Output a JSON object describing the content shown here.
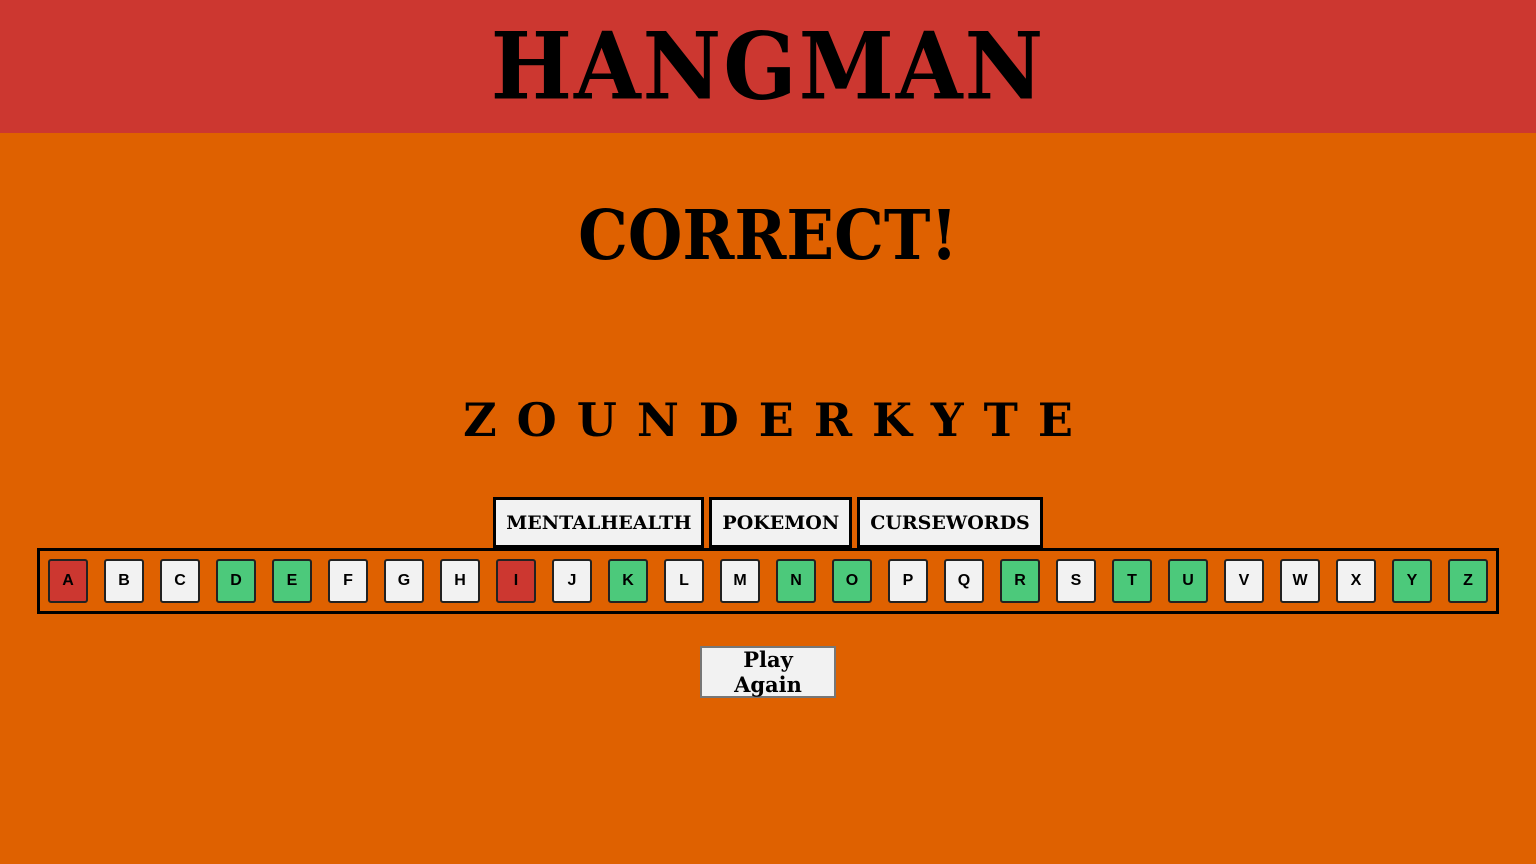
{
  "header": {
    "title": "HANGMAN"
  },
  "game": {
    "status": "CORRECT!",
    "word": "ZOUNDERKYTE"
  },
  "categories": [
    "MENTALHEALTH",
    "POKEMON",
    "CURSEWORDS"
  ],
  "keyboard": {
    "keys": [
      {
        "letter": "A",
        "state": "wrong"
      },
      {
        "letter": "B",
        "state": "unused"
      },
      {
        "letter": "C",
        "state": "unused"
      },
      {
        "letter": "D",
        "state": "correct"
      },
      {
        "letter": "E",
        "state": "correct"
      },
      {
        "letter": "F",
        "state": "unused"
      },
      {
        "letter": "G",
        "state": "unused"
      },
      {
        "letter": "H",
        "state": "unused"
      },
      {
        "letter": "I",
        "state": "wrong"
      },
      {
        "letter": "J",
        "state": "unused"
      },
      {
        "letter": "K",
        "state": "correct"
      },
      {
        "letter": "L",
        "state": "unused"
      },
      {
        "letter": "M",
        "state": "unused"
      },
      {
        "letter": "N",
        "state": "correct"
      },
      {
        "letter": "O",
        "state": "correct"
      },
      {
        "letter": "P",
        "state": "unused"
      },
      {
        "letter": "Q",
        "state": "unused"
      },
      {
        "letter": "R",
        "state": "correct"
      },
      {
        "letter": "S",
        "state": "unused"
      },
      {
        "letter": "T",
        "state": "correct"
      },
      {
        "letter": "U",
        "state": "correct"
      },
      {
        "letter": "V",
        "state": "unused"
      },
      {
        "letter": "W",
        "state": "unused"
      },
      {
        "letter": "X",
        "state": "unused"
      },
      {
        "letter": "Y",
        "state": "correct"
      },
      {
        "letter": "Z",
        "state": "correct"
      }
    ]
  },
  "actions": {
    "play_again_label": "Play Again"
  },
  "colors": {
    "header_bg": "#cc3730",
    "page_bg": "#df6100",
    "correct": "#4cc97b",
    "wrong": "#cc3730",
    "unused": "#f2f2f2"
  }
}
